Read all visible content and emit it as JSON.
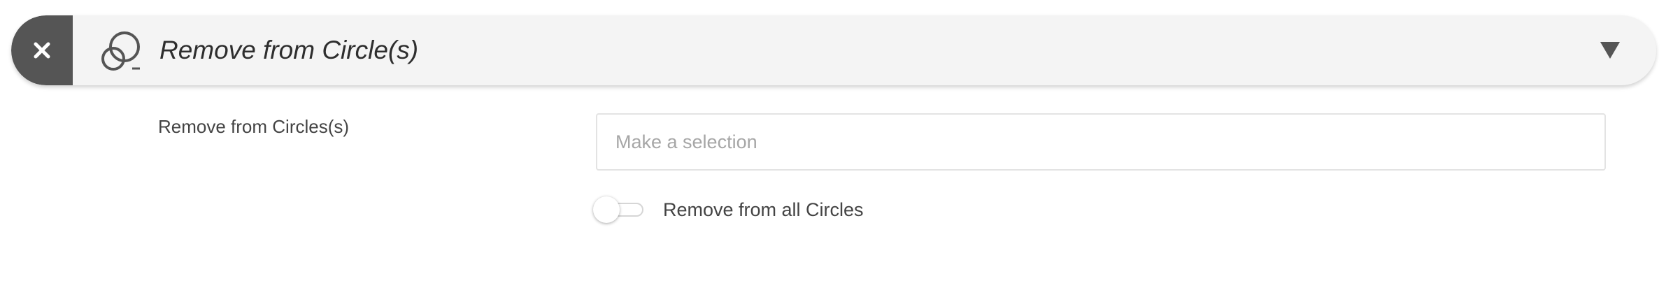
{
  "header": {
    "title": "Remove from Circle(s)",
    "close_icon": "close-icon",
    "circles_icon": "circles-minus-icon",
    "collapse_icon": "triangle-down-icon"
  },
  "form": {
    "field_label": "Remove from Circles(s)",
    "select_placeholder": "Make a selection",
    "toggle_label": "Remove from all Circles",
    "toggle_on": false
  },
  "colors": {
    "header_bg": "#f4f4f4",
    "close_bg": "#555555",
    "text": "#3c3c3c",
    "placeholder": "#a6a6a6"
  }
}
